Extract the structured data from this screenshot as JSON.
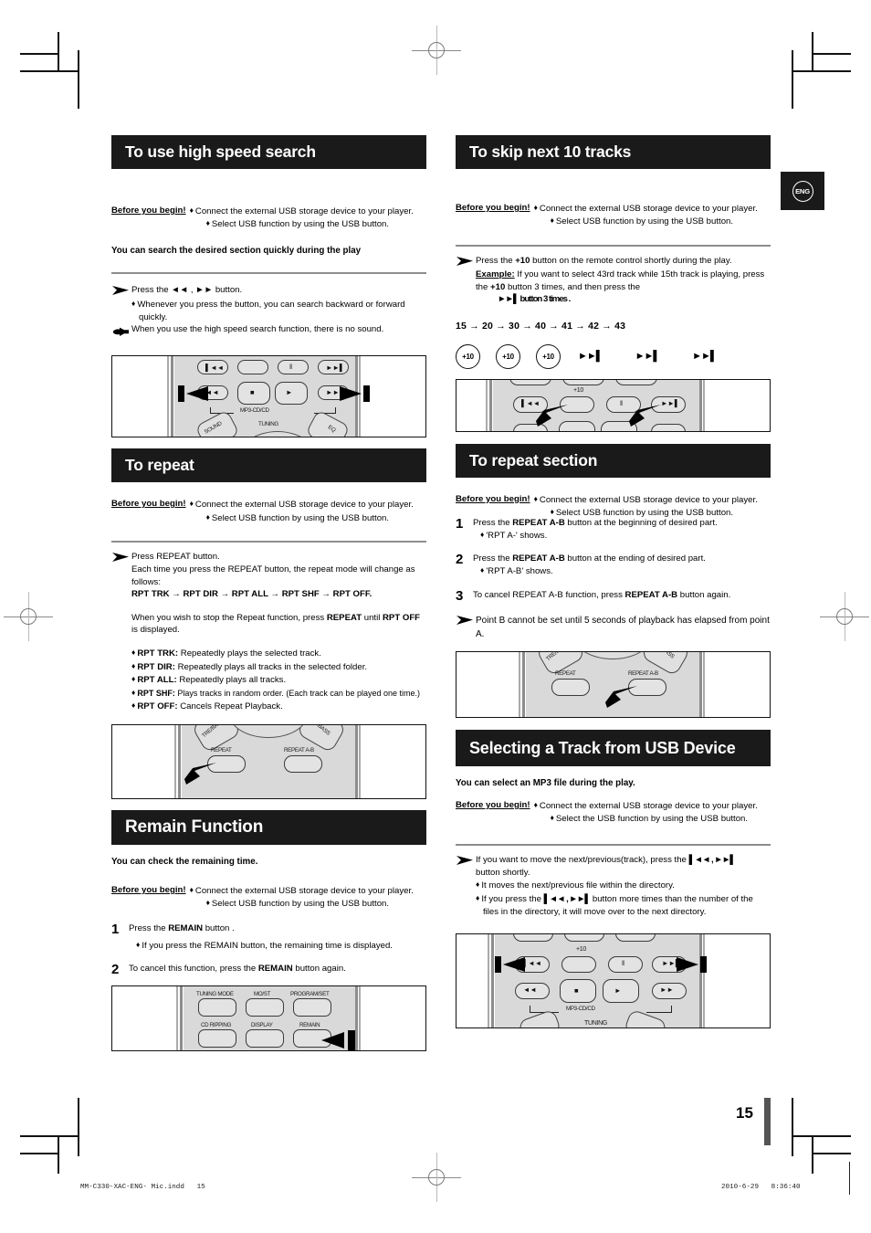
{
  "page": {
    "number": "15",
    "lang_badge": "ENG",
    "footer_left": "MM-C330-XAC-ENG- Mic.indd   15",
    "footer_right": "2010-6-29   8:36:40"
  },
  "common": {
    "before_label": "Before you begin!",
    "before_item1": "Connect the external USB storage device to your player.",
    "before_item2": "Select USB function by using the USB button.",
    "before_item2_alt": "Select the USB function by using the USB button.",
    "diamond": "♦",
    "arrow": "→"
  },
  "sections": {
    "high_speed_search": {
      "title": "To use high speed search",
      "subtitle": "You can search the desired section quickly during the play",
      "arrow_line1": "Press the ◄◄ ,  ►►  button.",
      "bullet1": "Whenever you press the button, you can search backward or forward quickly.",
      "hand_line": "When you use the high speed search function, there is no sound."
    },
    "repeat": {
      "title": "To repeat",
      "line1": "Press REPEAT button.",
      "line2": "Each time you press the REPEAT button, the repeat mode will change as follows:",
      "chain": "RPT TRK → RPT DIR → RPT ALL → RPT SHF → RPT OFF.",
      "stop_note_a": "When you wish to stop the Repeat function, press ",
      "stop_note_b": "REPEAT",
      "stop_note_c": " until ",
      "stop_note_d": "RPT OFF",
      "stop_note_e": " is displayed.",
      "modes": [
        {
          "name": "RPT TRK:",
          "desc": "Repeatedly plays the selected track."
        },
        {
          "name": "RPT DIR:",
          "desc": "Repeatedly plays all tracks in the selected folder."
        },
        {
          "name": "RPT ALL:",
          "desc": "Repeatedly plays all tracks."
        },
        {
          "name": "RPT SHF:",
          "desc": "Plays tracks in random order. (Each track can be played one time.)"
        },
        {
          "name": "RPT OFF:",
          "desc": "Cancels Repeat Playback."
        }
      ]
    },
    "remain": {
      "title": "Remain Function",
      "subtitle": "You can check the remaining time.",
      "step1_n": "1",
      "step1_a": "Press the ",
      "step1_b": "REMAIN",
      "step1_c": " button .",
      "step1_bullet": "If you press the REMAIN button, the remaining time is displayed.",
      "step2_n": "2",
      "step2_a": "To cancel this function, press the ",
      "step2_b": "REMAIN",
      "step2_c": " button again."
    },
    "skip10": {
      "title": "To skip next 10 tracks",
      "line_a": "Press the ",
      "line_b": "+10",
      "line_c": " button on the remote control shortly during the play.",
      "example_lbl": "Example:",
      "example_a": " If you want to select 43rd track while 15th track is playing, press the ",
      "example_b": "+10",
      "example_c": " button 3 times, and then press the",
      "example_d": "►►▌  button 3 times .",
      "sequence": "15 →  20 →  30 →  40 →  41 →  42 →  43",
      "callout_plus10": "+10",
      "callout_next": "►►▌"
    },
    "repeat_section": {
      "title": "To repeat section",
      "step1_n": "1",
      "step1_a": "Press the ",
      "step1_b": "REPEAT A-B",
      "step1_c": " button at the beginning of desired part.",
      "step1_bullet": "'RPT A-' shows.",
      "step2_n": "2",
      "step2_a": "Press the ",
      "step2_b": "REPEAT A-B",
      "step2_c": " button at the ending of desired part.",
      "step2_bullet": "'RPT A-B' shows.",
      "step3_n": "3",
      "step3_a": "To cancel REPEAT A-B function, press ",
      "step3_b": "REPEAT A-B",
      "step3_c": " button again.",
      "note": "Point B cannot be set until 5 seconds of playback has elapsed from point A."
    },
    "select_track": {
      "title": "Selecting a Track from USB Device",
      "subtitle": "You can select an MP3 file during the play.",
      "arrow_a": "If you want to move the next/previous(track), press the ",
      "arrow_b": "▌◄◄ , ►►▌",
      "arrow_c": "button shortly.",
      "bullet1": "It moves the next/previous file within the directory.",
      "bullet2_a": "If you press the ",
      "bullet2_b": "▌◄◄ , ►►▌",
      "bullet2_c": " button more times than the number of the files in the directory, it will move over to the next directory."
    }
  },
  "remote_labels": {
    "mp3_cd": "MP3-CD/CD",
    "tuning": "TUNING",
    "sound": "SOUND",
    "eq": "EQ",
    "treble_bass": "TRE/BASS",
    "pbass": "P.BASS",
    "repeat": "REPEAT",
    "repeat_ab": "REPEAT A-B",
    "tuning_mode": "TUNING MODE",
    "most": "MO/ST",
    "program_set": "PROGRAM/SET",
    "cd_ripping": "CD RIPPING",
    "display": "DISPLAY",
    "remain": "REMAIN",
    "plus10": "+10",
    "prev": "▌◄◄",
    "next": "►►▌",
    "pause": "‖",
    "rew": "◄◄",
    "ff": "►►",
    "stop": "■",
    "play": "►"
  },
  "colors": {
    "bar_bg": "#1a1a1a",
    "bar_fg": "#ffffff",
    "rule": "#8d8d8d",
    "remote_body": "#d9d9d9",
    "button_face": "#e3e3e3"
  }
}
